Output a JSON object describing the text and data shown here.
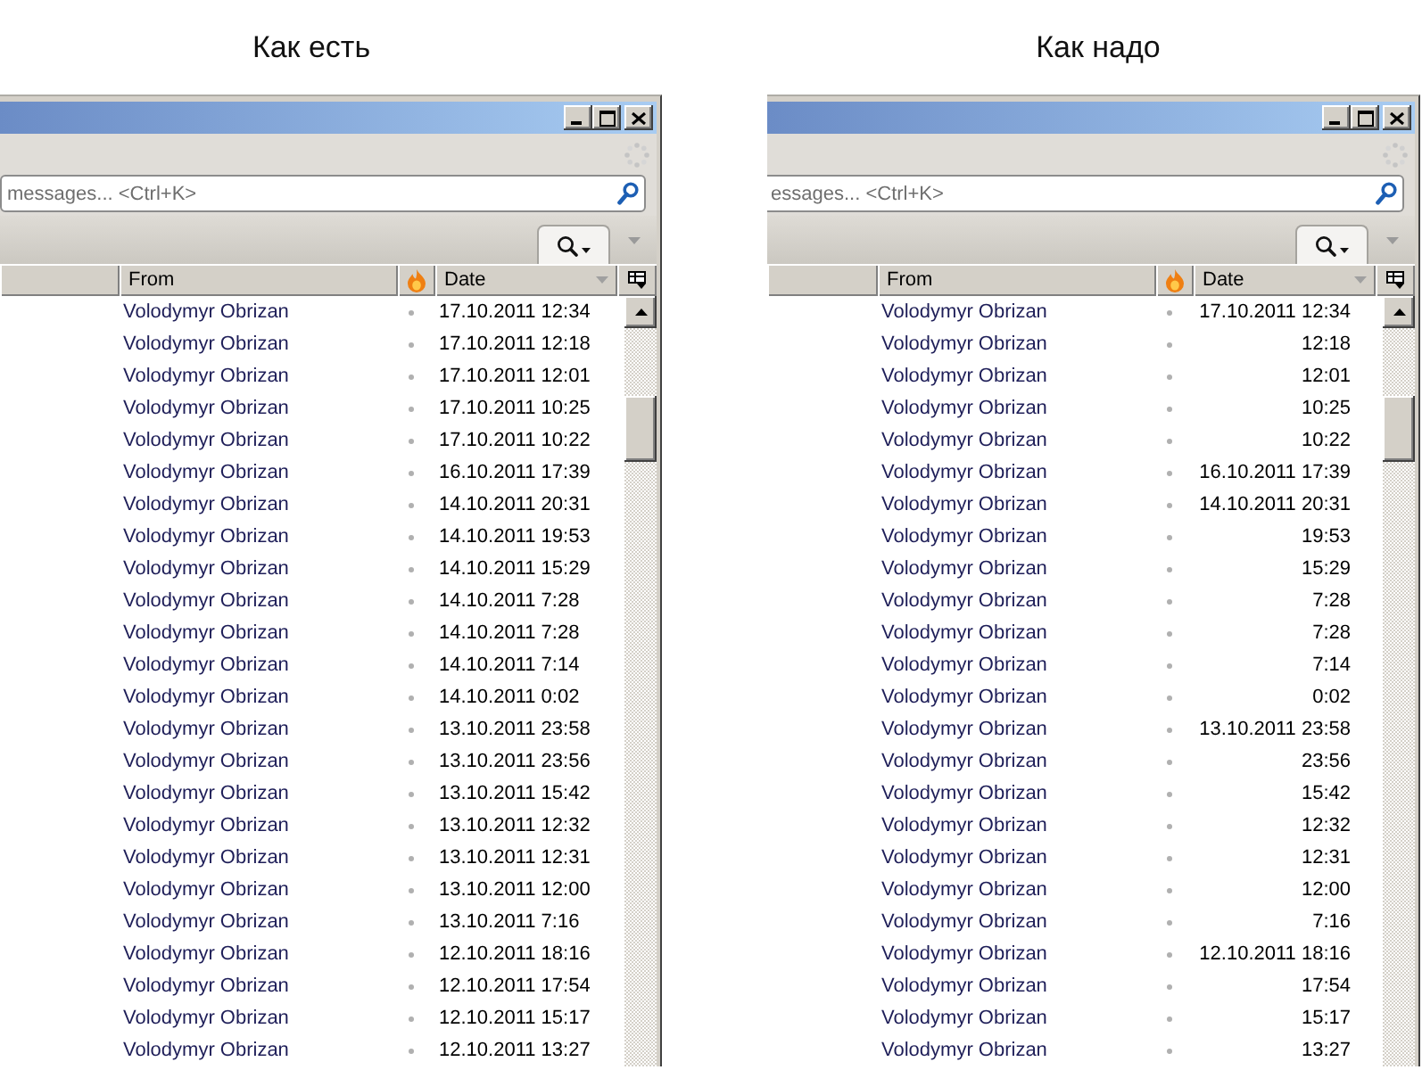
{
  "panels": [
    {
      "caption": "Как есть",
      "kind": "plain",
      "search": {
        "placeholder": "messages... <Ctrl+K>"
      },
      "columns": [
        {
          "kind": "blank",
          "sorted": false
        },
        {
          "kind": "text",
          "label": "From",
          "sorted": false
        },
        {
          "kind": "junk",
          "sorted": false
        },
        {
          "kind": "text",
          "label": "Date",
          "sorted": true
        }
      ],
      "rows": [
        {
          "from": "Volodymyr Obrizan",
          "date": "17.10.2011 12:34"
        },
        {
          "from": "Volodymyr Obrizan",
          "date": "17.10.2011 12:18"
        },
        {
          "from": "Volodymyr Obrizan",
          "date": "17.10.2011 12:01"
        },
        {
          "from": "Volodymyr Obrizan",
          "date": "17.10.2011 10:25"
        },
        {
          "from": "Volodymyr Obrizan",
          "date": "17.10.2011 10:22"
        },
        {
          "from": "Volodymyr Obrizan",
          "date": "16.10.2011 17:39"
        },
        {
          "from": "Volodymyr Obrizan",
          "date": "14.10.2011 20:31"
        },
        {
          "from": "Volodymyr Obrizan",
          "date": "14.10.2011 19:53"
        },
        {
          "from": "Volodymyr Obrizan",
          "date": "14.10.2011 15:29"
        },
        {
          "from": "Volodymyr Obrizan",
          "date": "14.10.2011 7:28"
        },
        {
          "from": "Volodymyr Obrizan",
          "date": "14.10.2011 7:28"
        },
        {
          "from": "Volodymyr Obrizan",
          "date": "14.10.2011 7:14"
        },
        {
          "from": "Volodymyr Obrizan",
          "date": "14.10.2011 0:02"
        },
        {
          "from": "Volodymyr Obrizan",
          "date": "13.10.2011 23:58"
        },
        {
          "from": "Volodymyr Obrizan",
          "date": "13.10.2011 23:56"
        },
        {
          "from": "Volodymyr Obrizan",
          "date": "13.10.2011 15:42"
        },
        {
          "from": "Volodymyr Obrizan",
          "date": "13.10.2011 12:32"
        },
        {
          "from": "Volodymyr Obrizan",
          "date": "13.10.2011 12:31"
        },
        {
          "from": "Volodymyr Obrizan",
          "date": "13.10.2011 12:00"
        },
        {
          "from": "Volodymyr Obrizan",
          "date": "13.10.2011 7:16"
        },
        {
          "from": "Volodymyr Obrizan",
          "date": "12.10.2011 18:16"
        },
        {
          "from": "Volodymyr Obrizan",
          "date": "12.10.2011 17:54"
        },
        {
          "from": "Volodymyr Obrizan",
          "date": "12.10.2011 15:17"
        },
        {
          "from": "Volodymyr Obrizan",
          "date": "12.10.2011 13:27"
        }
      ]
    },
    {
      "caption": "Как надо",
      "kind": "grouped",
      "search": {
        "placeholder": "essages... <Ctrl+K>"
      },
      "columns": [
        {
          "kind": "blank",
          "sorted": false
        },
        {
          "kind": "text",
          "label": "From",
          "sorted": false
        },
        {
          "kind": "junk",
          "sorted": false
        },
        {
          "kind": "text",
          "label": "Date",
          "sorted": true
        }
      ],
      "rows": [
        {
          "from": "Volodymyr Obrizan",
          "date": "17.10.2011 12:34"
        },
        {
          "from": "Volodymyr Obrizan",
          "date": "12:18"
        },
        {
          "from": "Volodymyr Obrizan",
          "date": "12:01"
        },
        {
          "from": "Volodymyr Obrizan",
          "date": "10:25"
        },
        {
          "from": "Volodymyr Obrizan",
          "date": "10:22"
        },
        {
          "from": "Volodymyr Obrizan",
          "date": "16.10.2011 17:39"
        },
        {
          "from": "Volodymyr Obrizan",
          "date": "14.10.2011 20:31"
        },
        {
          "from": "Volodymyr Obrizan",
          "date": "19:53"
        },
        {
          "from": "Volodymyr Obrizan",
          "date": "15:29"
        },
        {
          "from": "Volodymyr Obrizan",
          "date": "7:28"
        },
        {
          "from": "Volodymyr Obrizan",
          "date": "7:28"
        },
        {
          "from": "Volodymyr Obrizan",
          "date": "7:14"
        },
        {
          "from": "Volodymyr Obrizan",
          "date": "0:02"
        },
        {
          "from": "Volodymyr Obrizan",
          "date": "13.10.2011 23:58"
        },
        {
          "from": "Volodymyr Obrizan",
          "date": "23:56"
        },
        {
          "from": "Volodymyr Obrizan",
          "date": "15:42"
        },
        {
          "from": "Volodymyr Obrizan",
          "date": "12:32"
        },
        {
          "from": "Volodymyr Obrizan",
          "date": "12:31"
        },
        {
          "from": "Volodymyr Obrizan",
          "date": "12:00"
        },
        {
          "from": "Volodymyr Obrizan",
          "date": "7:16"
        },
        {
          "from": "Volodymyr Obrizan",
          "date": "12.10.2011 18:16"
        },
        {
          "from": "Volodymyr Obrizan",
          "date": "17:54"
        },
        {
          "from": "Volodymyr Obrizan",
          "date": "15:17"
        },
        {
          "from": "Volodymyr Obrizan",
          "date": "13:27"
        }
      ]
    }
  ]
}
